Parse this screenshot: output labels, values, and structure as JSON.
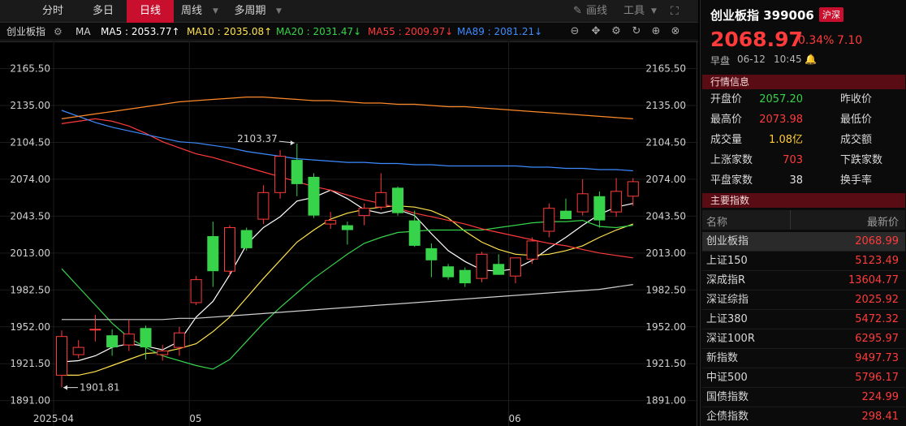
{
  "toolbar": {
    "tabs": [
      "分时",
      "多日",
      "日线",
      "周线",
      "多周期"
    ],
    "active": "日线",
    "draw": "画线",
    "tools": "工具"
  },
  "ma": {
    "name": "创业板指",
    "type": "MA",
    "ma5": "MA5 : 2053.77↑",
    "ma10": "MA10 : 2035.08↑",
    "ma20": "MA20 : 2031.47↓",
    "ma55": "MA55 : 2009.97↓",
    "ma89": "MA89 : 2081.21↓",
    "colors": {
      "ma5": "#ffffff",
      "ma10": "#ffe34d",
      "ma20": "#37d34a",
      "ma55": "#ff3a3a",
      "ma89": "#3d8bff",
      "ma120": "#ff8a2a",
      "ma250": "#cfcfcf"
    }
  },
  "panel": {
    "title": "创业板指 399006",
    "badge": "沪深",
    "price": "2068.97",
    "pct": "0.34%",
    "change": "7.10",
    "session": "早盘",
    "date": "06-12",
    "time": "10:45",
    "quote_header": "行情信息",
    "quotes": [
      {
        "l1": "开盘价",
        "v": "2057.20",
        "c": "#37d34a",
        "l2": "昨收价"
      },
      {
        "l1": "最高价",
        "v": "2073.98",
        "c": "#ff3b3b",
        "l2": "最低价"
      },
      {
        "l1": "成交量",
        "v": "1.08亿",
        "c": "#ffcc33",
        "l2": "成交额"
      },
      {
        "l1": "上涨家数",
        "v": "703",
        "c": "#ff3b3b",
        "l2": "下跌家数"
      },
      {
        "l1": "平盘家数",
        "v": "38",
        "c": "#e0e0e0",
        "l2": "换手率"
      }
    ],
    "index_header": "主要指数",
    "col_name": "名称",
    "col_price": "最新价",
    "indices": [
      {
        "name": "创业板指",
        "value": "2068.99"
      },
      {
        "name": "上证150",
        "value": "5123.49"
      },
      {
        "name": "深成指R",
        "value": "13604.77"
      },
      {
        "name": "深证综指",
        "value": "2025.92"
      },
      {
        "name": "上证380",
        "value": "5472.32"
      },
      {
        "name": "深证100R",
        "value": "6295.97"
      },
      {
        "name": "新指数",
        "value": "9497.73"
      },
      {
        "name": "中证500",
        "value": "5796.17"
      },
      {
        "name": "国债指数",
        "value": "224.99"
      },
      {
        "name": "企债指数",
        "value": "298.41"
      }
    ]
  },
  "chart_data": {
    "type": "candlestick",
    "ylim": [
      1870,
      2188
    ],
    "yticks": [
      2165.5,
      2135.0,
      2104.5,
      2074.0,
      2043.5,
      2013.0,
      1982.5,
      1952.0,
      1921.5,
      1891.0
    ],
    "ytick_labels": [
      "2165.50",
      "2135.00",
      "2104.50",
      "2074.00",
      "2043.50",
      "2013.00",
      "1982.50",
      "1952.00",
      "1921.50",
      "1891.00"
    ],
    "xlabels": [
      {
        "label": "2025-04",
        "index": 0
      },
      {
        "label": "05",
        "index": 8
      },
      {
        "label": "06",
        "index": 27
      }
    ],
    "high_annotation": {
      "label": "2103.37",
      "index": 14,
      "value": 2103.37
    },
    "low_annotation": {
      "label": "1901.81",
      "index": 0,
      "value": 1901.81
    },
    "candles": [
      {
        "o": 1912,
        "h": 1949,
        "l": 1902,
        "c": 1944
      },
      {
        "o": 1929,
        "h": 1941,
        "l": 1926,
        "c": 1935
      },
      {
        "o": 1950,
        "h": 1962,
        "l": 1940,
        "c": 1950
      },
      {
        "o": 1945,
        "h": 1950,
        "l": 1928,
        "c": 1935
      },
      {
        "o": 1937,
        "h": 1958,
        "l": 1932,
        "c": 1946
      },
      {
        "o": 1951,
        "h": 1953,
        "l": 1925,
        "c": 1935
      },
      {
        "o": 1929,
        "h": 1937,
        "l": 1924,
        "c": 1932
      },
      {
        "o": 1935,
        "h": 1952,
        "l": 1928,
        "c": 1947
      },
      {
        "o": 1972,
        "h": 1994,
        "l": 1970,
        "c": 1991
      },
      {
        "o": 2027,
        "h": 2039,
        "l": 1985,
        "c": 1998
      },
      {
        "o": 1998,
        "h": 2036,
        "l": 1994,
        "c": 2034
      },
      {
        "o": 2032,
        "h": 2034,
        "l": 2015,
        "c": 2017
      },
      {
        "o": 2041,
        "h": 2069,
        "l": 2037,
        "c": 2063
      },
      {
        "o": 2063,
        "h": 2098,
        "l": 2058,
        "c": 2093
      },
      {
        "o": 2090,
        "h": 2103.37,
        "l": 2060,
        "c": 2070
      },
      {
        "o": 2076,
        "h": 2079,
        "l": 2042,
        "c": 2044
      },
      {
        "o": 2037,
        "h": 2047,
        "l": 2033,
        "c": 2040
      },
      {
        "o": 2036,
        "h": 2039,
        "l": 2020,
        "c": 2032
      },
      {
        "o": 2044,
        "h": 2054,
        "l": 2036,
        "c": 2050
      },
      {
        "o": 2051,
        "h": 2079,
        "l": 2049,
        "c": 2063
      },
      {
        "o": 2067,
        "h": 2068,
        "l": 2044,
        "c": 2046
      },
      {
        "o": 2040,
        "h": 2048,
        "l": 2018,
        "c": 2019
      },
      {
        "o": 2017,
        "h": 2021,
        "l": 1993,
        "c": 2007
      },
      {
        "o": 2002,
        "h": 2004,
        "l": 1991,
        "c": 1993
      },
      {
        "o": 1999,
        "h": 2001,
        "l": 1985,
        "c": 1988
      },
      {
        "o": 1992,
        "h": 2014,
        "l": 1989,
        "c": 2012
      },
      {
        "o": 2004,
        "h": 2012,
        "l": 1995,
        "c": 1995
      },
      {
        "o": 1994,
        "h": 2007,
        "l": 1988,
        "c": 2009
      },
      {
        "o": 2008,
        "h": 2026,
        "l": 2004,
        "c": 2023
      },
      {
        "o": 2031,
        "h": 2054,
        "l": 2026,
        "c": 2050
      },
      {
        "o": 2048,
        "h": 2058,
        "l": 2041,
        "c": 2041
      },
      {
        "o": 2047,
        "h": 2074,
        "l": 2044,
        "c": 2062
      },
      {
        "o": 2060,
        "h": 2064,
        "l": 2034,
        "c": 2040
      },
      {
        "o": 2047,
        "h": 2075,
        "l": 2043,
        "c": 2064
      },
      {
        "o": 2060,
        "h": 2075,
        "l": 2052,
        "c": 2072
      }
    ],
    "series": [
      {
        "key": "ma5",
        "values": [
          1923,
          1924,
          1928,
          1935,
          1938,
          1936,
          1933,
          1940,
          1960,
          1973,
          1995,
          2020,
          2034,
          2043,
          2056,
          2059,
          2065,
          2058,
          2049,
          2046,
          2049,
          2044,
          2029,
          2015,
          2006,
          1999,
          1998,
          2000,
          2007,
          2017,
          2026,
          2036,
          2045,
          2051,
          2054
        ]
      },
      {
        "key": "ma10",
        "values": [
          1912,
          1912,
          1915,
          1920,
          1925,
          1930,
          1931,
          1934,
          1938,
          1948,
          1960,
          1976,
          1992,
          2007,
          2022,
          2032,
          2041,
          2046,
          2049,
          2051,
          2052,
          2051,
          2048,
          2042,
          2031,
          2022,
          2016,
          2012,
          2011,
          2012,
          2015,
          2019,
          2026,
          2032,
          2037
        ]
      },
      {
        "key": "ma20",
        "values": [
          2000,
          1985,
          1970,
          1955,
          1943,
          1935,
          1928,
          1924,
          1920,
          1917,
          1925,
          1940,
          1955,
          1968,
          1980,
          1992,
          2002,
          2012,
          2021,
          2026,
          2030,
          2031,
          2032,
          2032,
          2032,
          2032,
          2034,
          2036,
          2038,
          2039,
          2039,
          2040,
          2035,
          2034,
          2036
        ]
      },
      {
        "key": "ma55",
        "values": [
          2120,
          2122,
          2124,
          2122,
          2118,
          2112,
          2105,
          2100,
          2095,
          2092,
          2088,
          2084,
          2080,
          2076,
          2072,
          2068,
          2065,
          2061,
          2057,
          2054,
          2050,
          2046,
          2043,
          2040,
          2037,
          2033,
          2030,
          2027,
          2024,
          2021,
          2019,
          2016,
          2013,
          2011,
          2009
        ]
      },
      {
        "key": "ma89",
        "values": [
          2131,
          2126,
          2121,
          2117,
          2114,
          2111,
          2108,
          2105,
          2104,
          2102,
          2100,
          2097,
          2095,
          2093,
          2091,
          2090,
          2089,
          2088,
          2088,
          2087,
          2087,
          2086,
          2086,
          2085,
          2085,
          2085,
          2085,
          2085,
          2084,
          2084,
          2083,
          2083,
          2082,
          2082,
          2081
        ]
      },
      {
        "key": "ma120",
        "values": [
          2124,
          2126,
          2128,
          2130,
          2132,
          2134,
          2136,
          2138,
          2139,
          2140,
          2141,
          2142,
          2142,
          2141,
          2140,
          2139,
          2139,
          2138,
          2137,
          2137,
          2136,
          2136,
          2135,
          2134,
          2134,
          2133,
          2132,
          2131,
          2130,
          2129,
          2128,
          2127,
          2126,
          2125,
          2124
        ]
      },
      {
        "key": "ma250",
        "values": [
          1958,
          1958,
          1958,
          1958,
          1958,
          1958,
          1958,
          1959,
          1959,
          1960,
          1961,
          1962,
          1963,
          1964,
          1965,
          1966,
          1967,
          1968,
          1969,
          1970,
          1971,
          1972,
          1973,
          1974,
          1975,
          1976,
          1977,
          1978,
          1979,
          1980,
          1981,
          1982,
          1983,
          1985,
          1987
        ]
      }
    ]
  }
}
